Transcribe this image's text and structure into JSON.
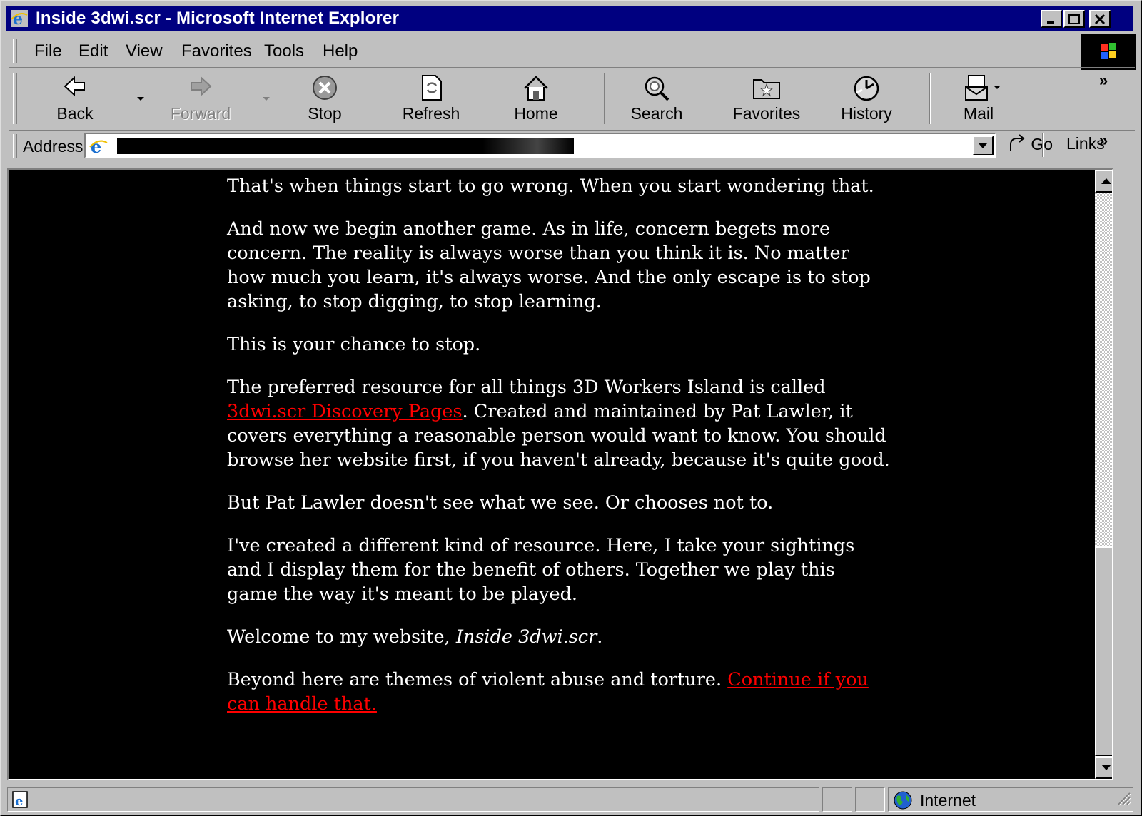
{
  "window": {
    "title": "Inside 3dwi.scr - Microsoft Internet Explorer"
  },
  "menu": {
    "items": [
      "File",
      "Edit",
      "View",
      "Favorites",
      "Tools",
      "Help"
    ]
  },
  "toolbar": {
    "back": "Back",
    "forward": "Forward",
    "stop": "Stop",
    "refresh": "Refresh",
    "home": "Home",
    "search": "Search",
    "favorites": "Favorites",
    "history": "History",
    "mail": "Mail"
  },
  "address": {
    "label": "Address",
    "go": "Go",
    "links": "Links"
  },
  "page": {
    "p1": "That's when things start to go wrong. When you start wondering that.",
    "p2": "And now we begin another game. As in life, concern begets more concern. The reality is always worse than you think it is. No matter how much you learn, it's always worse. And the only escape is to stop asking, to stop digging, to stop learning.",
    "p3": "This is your chance to stop.",
    "p4_before": "The preferred resource for all things 3D Workers Island is called ",
    "p4_link": "3dwi.scr Discovery Pages",
    "p4_after": ". Created and maintained by Pat Lawler, it covers everything a reasonable person would want to know. You should browse her website first, if you haven't already, because it's quite good.",
    "p5": "But Pat Lawler doesn't see what we see. Or chooses not to.",
    "p6": "I've created a different kind of resource. Here, I take your sightings and I display them for the benefit of others. Together we play this game the way it's meant to be played.",
    "p7_before": "Welcome to my website, ",
    "p7_italic": "Inside 3dwi.scr",
    "p7_after": ".",
    "p8_before": "Beyond here are themes of violent abuse and torture. ",
    "p8_link": "Continue if you can handle that."
  },
  "status": {
    "zone": "Internet"
  }
}
